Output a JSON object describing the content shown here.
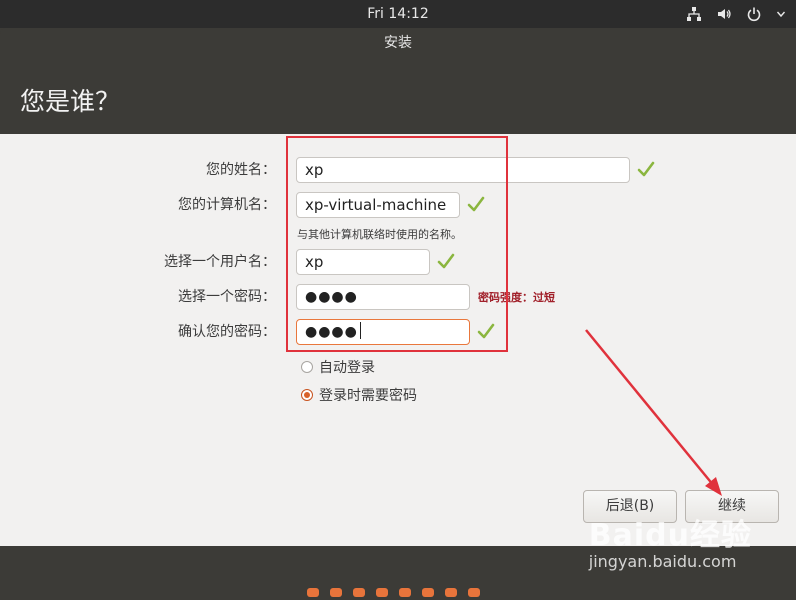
{
  "topbar": {
    "clock": "Fri 14:12",
    "tray_icons": [
      "network-icon",
      "volume-icon",
      "power-icon"
    ]
  },
  "window": {
    "title": "安装",
    "page_title": "您是谁？"
  },
  "form": {
    "name_label": "您的姓名：",
    "name_value": "xp",
    "computer_label": "您的计算机名：",
    "computer_value": "xp-virtual-machine",
    "computer_hint": "与其他计算机联络时使用的名称。",
    "username_label": "选择一个用户名：",
    "username_value": "xp",
    "password_label": "选择一个密码：",
    "password_value": "●●●●",
    "password_strength": "密码强度：过短",
    "confirm_label": "确认您的密码：",
    "confirm_value": "●●●●",
    "auto_login_label": "自动登录",
    "require_password_label": "登录时需要密码",
    "selected_option": "登录时需要密码"
  },
  "buttons": {
    "back_label": "后退(B)",
    "continue_label": "继续"
  },
  "progress": {
    "total_steps": 8
  },
  "watermark": {
    "logo": "Baidu经验",
    "url": "jingyan.baidu.com"
  },
  "colors": {
    "accent": "#e9773c",
    "check": "#8bb63f",
    "annotation_red": "#e0323c",
    "strength_text": "#a1202a"
  }
}
